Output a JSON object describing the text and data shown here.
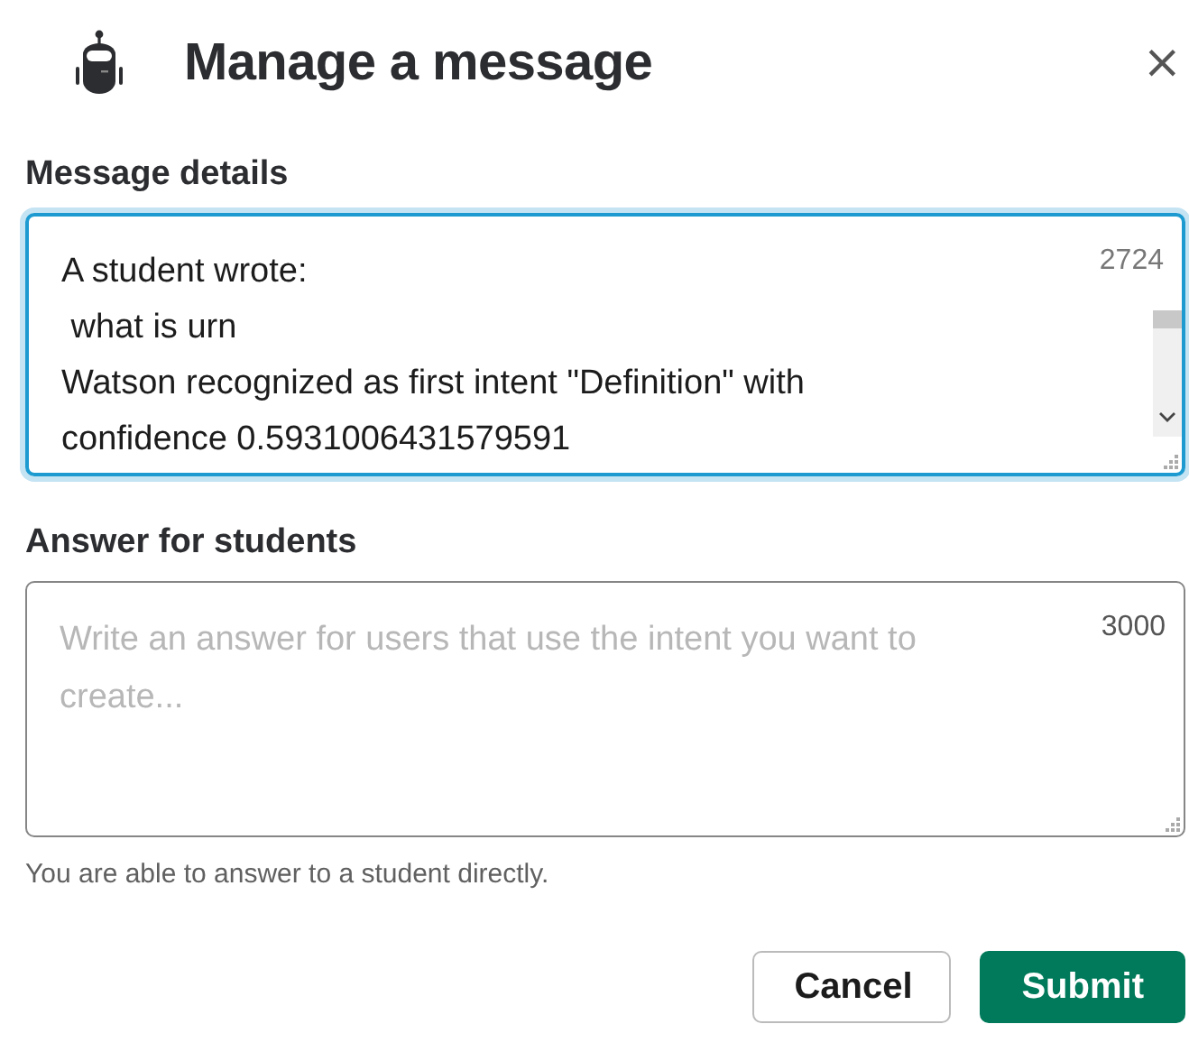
{
  "dialog": {
    "title": "Manage a message",
    "close": "×"
  },
  "message_details": {
    "label": "Message details",
    "value": "A student wrote:\n what is urn\nWatson recognized as first intent \"Definition\" with confidence 0.5931006431579591",
    "counter": "2724",
    "focused": true
  },
  "answer": {
    "label": "Answer for students",
    "placeholder": "Write an answer for users that use the intent you want to create...",
    "counter": "3000",
    "focused": false,
    "hint": "You are able to answer to a student directly."
  },
  "buttons": [
    {
      "label": "Cancel",
      "kind": "secondary"
    },
    {
      "label": "Submit",
      "kind": "primary"
    }
  ]
}
